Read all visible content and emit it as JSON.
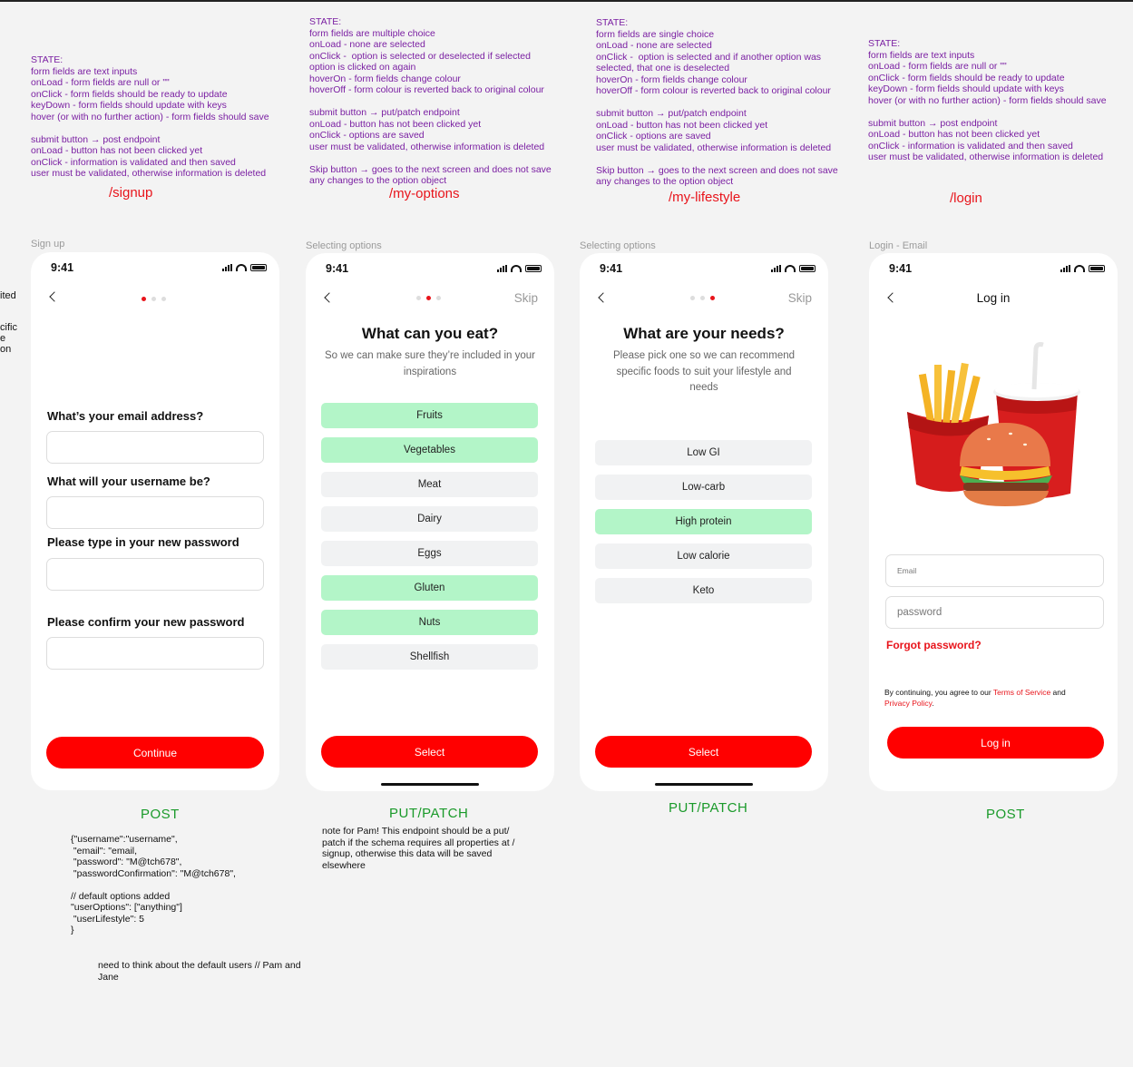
{
  "status_time": "9:41",
  "notes": {
    "signup": "STATE:\nform fields are text inputs\nonLoad - form fields are null or \"\"\nonClick - form fields should be ready to update\nkeyDown - form fields should update with keys\nhover (or with no further action) - form fields should save\n\nsubmit button → post endpoint\nonLoad - button has not been clicked yet\nonClick - information is validated and then saved\nuser must be validated, otherwise information is deleted",
    "options": "STATE:\nform fields are multiple choice\nonLoad - none are selected\nonClick -  option is selected or deselected if selected\noption is clicked on again\nhoverOn - form fields change colour\nhoverOff - form colour is reverted back to original colour\n\nsubmit button → put/patch endpoint\nonLoad - button has not been clicked yet\nonClick - options are saved\nuser must be validated, otherwise information is deleted\n\nSkip button → goes to the next screen and does not save\nany changes to the option object",
    "lifestyle": "STATE:\nform fields are single choice\nonLoad - none are selected\nonClick -  option is selected and if another option was\nselected, that one is deselected\nhoverOn - form fields change colour\nhoverOff - form colour is reverted back to original colour\n\nsubmit button → put/patch endpoint\nonLoad - button has not been clicked yet\nonClick - options are saved\nuser must be validated, otherwise information is deleted\n\nSkip button → goes to the next screen and does not save\nany changes to the option object",
    "login": "STATE:\nform fields are text inputs\nonLoad - form fields are null or \"\"\nonClick - form fields should be ready to update\nkeyDown - form fields should update with keys\nhover (or with no further action) - form fields should save\n\nsubmit button → post endpoint\nonLoad - button has not been clicked yet\nonClick - information is validated and then saved\nuser must be validated, otherwise information is deleted"
  },
  "cutoff_text": [
    "ited",
    "cific",
    "e",
    "on"
  ],
  "routes": {
    "signup": "/signup",
    "options": "/my-options",
    "lifestyle": "/my-lifestyle",
    "login": "/login"
  },
  "frame_labels": {
    "signup": "Sign up",
    "options": "Selecting options",
    "lifestyle": "Selecting options",
    "login": "Login - Email"
  },
  "verbs": {
    "signup": "POST",
    "options": "PUT/PATCH",
    "lifestyle": "PUT/PATCH",
    "login": "POST"
  },
  "signup_screen": {
    "q_email": "What’s your email address?",
    "q_username": "What will your username be?",
    "q_password": "Please type in your new password",
    "q_confirm": "Please confirm your new password",
    "continue": "Continue"
  },
  "options_screen": {
    "skip": "Skip",
    "title": "What can you eat?",
    "subtitle": "So we can make sure they’re included in your inspirations",
    "options": [
      "Fruits",
      "Vegetables",
      "Meat",
      "Dairy",
      "Eggs",
      "Gluten",
      "Nuts",
      "Shellfish"
    ],
    "selected": [
      true,
      true,
      false,
      false,
      false,
      true,
      true,
      false
    ],
    "select": "Select"
  },
  "lifestyle_screen": {
    "skip": "Skip",
    "title": "What are your needs?",
    "subtitle": "Please pick one so we can recommend specific foods to suit your lifestyle and needs",
    "options": [
      "Low GI",
      "Low-carb",
      "High protein",
      "Low calorie",
      "Keto"
    ],
    "selected": [
      false,
      false,
      true,
      false,
      false
    ],
    "select": "Select"
  },
  "login_screen": {
    "title": "Log in",
    "email_placeholder": "Email",
    "password_placeholder": "password",
    "forgot": "Forgot password?",
    "legal_prefix": "By continuing, you agree to our ",
    "terms": "Terms of Service",
    "legal_and": " and",
    "privacy": "Privacy Policy",
    "legal_end": ".",
    "login_button": "Log in"
  },
  "json_sample": "{\"username\":\"username\",\n \"email\": \"email,\n \"password\": \"M@tch678\",\n \"passwordConfirmation\": \"M@tch678\",\n\n// default options added\n\"userOptions\": [\"anything\"]\n \"userLifestyle\": 5\n}",
  "pam_note": "note for Pam! This endpoint should be a put/\npatch if the schema requires all properties at /\nsignup, otherwise this data will be saved\nelsewhere",
  "default_users_note": "need to think about the default users // Pam and\nJane",
  "colors": {
    "accent": "#ff0000",
    "selected": "#b3f5c8",
    "note": "#7a1fa2",
    "verb": "#1a9a2a"
  }
}
